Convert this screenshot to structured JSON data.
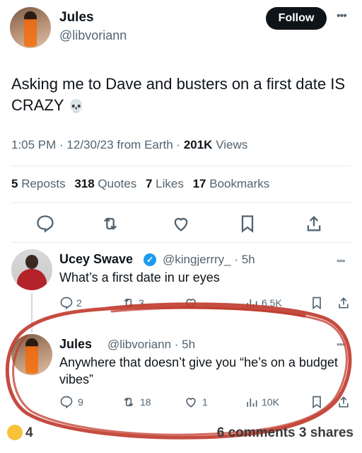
{
  "author": {
    "name": "Jules",
    "handle": "@libvoriann"
  },
  "follow_label": "Follow",
  "tweet": {
    "text": "Asking me to Dave and busters on a first date IS CRAZY",
    "emoji": "💀"
  },
  "meta": {
    "time": "1:05 PM",
    "date": "12/30/23",
    "source": "from Earth",
    "views_count": "201K",
    "views_label": "Views"
  },
  "stats": {
    "reposts_count": "5",
    "reposts_label": "Reposts",
    "quotes_count": "318",
    "quotes_label": "Quotes",
    "likes_count": "7",
    "likes_label": "Likes",
    "bookmarks_count": "17",
    "bookmarks_label": "Bookmarks"
  },
  "actions": [
    "reply-icon",
    "repost-icon",
    "like-icon",
    "bookmark-icon",
    "share-icon"
  ],
  "reply1": {
    "name": "Ucey Swave",
    "handle": "@kingjerrry_ · 5h",
    "text": "What’s a first date in ur eyes",
    "replies": "2",
    "reposts": "3",
    "views": "6.5K"
  },
  "reply2": {
    "name": "Jules",
    "handle": "@libvoriann · 5h",
    "text": "Anywhere that doesn’t give you “he’s on a budget vibes”",
    "replies": "9",
    "reposts": "18",
    "likes": "1",
    "views": "10K"
  },
  "footer": {
    "reactions": "4",
    "comments": "6 comments",
    "shares": "3 shares"
  },
  "colors": {
    "accent": "#1d9bf0",
    "scribble": "#c0392b",
    "text": "#0f1419",
    "muted": "#536471"
  }
}
